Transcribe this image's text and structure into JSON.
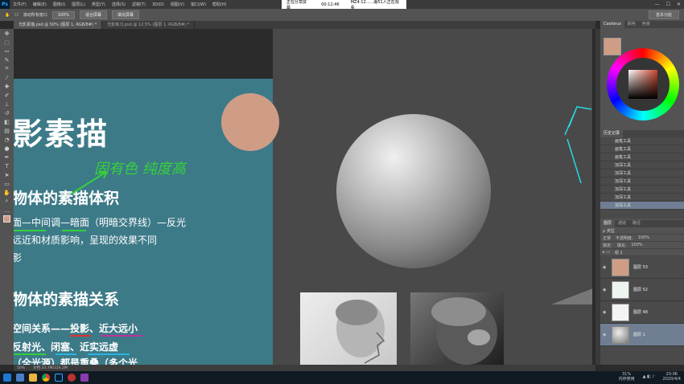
{
  "menubar": {
    "logo": "Ps",
    "items": [
      "文件(F)",
      "编辑(E)",
      "图像(I)",
      "图层(L)",
      "类型(Y)",
      "选择(S)",
      "滤镜(T)",
      "3D(D)",
      "视图(V)",
      "窗口(W)",
      "帮助(H)"
    ],
    "share_status": "正在分享屏幕",
    "share_time": "00:12:46",
    "share_viewers": "MZ4-12......服51人正在观看",
    "win_controls": [
      "—",
      "☐",
      "✕"
    ]
  },
  "options": {
    "checkbox_label": "滚动所有窗口",
    "zoom": "100%",
    "fit_screen": "适合屏幕",
    "fill_screen": "填充屏幕",
    "workspace": "基本功能"
  },
  "tabs": [
    {
      "label": "光影素描.psd @ 50% (图层 1, RGB/8#) *"
    },
    {
      "label": "光影练习.psd @ 12.5% (图层 1, RGB/8#) *"
    }
  ],
  "slide": {
    "title": "影素描",
    "line1": "物体的素描体积",
    "line2": "面—中间调—暗面（明暗交界线）—反光",
    "line3": "远近和材质影响，呈现的效果不同",
    "line4": "影",
    "line5": "物体的素描关系",
    "line6": "空间关系——投影、近大远小",
    "line7": "反射光、闭塞、近实远虚",
    "line8": "（全光源）都是重叠（多个光",
    "handwriting": "固有色 纯度高"
  },
  "status": {
    "zoom": "50%",
    "doc": "文档:33.7M/224.2M"
  },
  "panels": {
    "color_tabs": [
      "Coolorus",
      "颜色",
      "色板"
    ],
    "history_tabs": [
      "历史记录"
    ],
    "history_items": [
      "画笔工具",
      "画笔工具",
      "画笔工具",
      "加深工具",
      "加深工具",
      "加深工具",
      "加深工具",
      "加深工具",
      "加深工具"
    ],
    "layers_tabs": [
      "图层",
      "通道",
      "路径"
    ],
    "filter": "ρ 类型",
    "blend": "正常",
    "opacity_label": "不透明度:",
    "opacity": "100%",
    "lock_label": "锁定:",
    "fill_label": "填充:",
    "fill": "100%",
    "group": "组 2",
    "layers": [
      {
        "name": "图层 53"
      },
      {
        "name": "图层 52"
      },
      {
        "name": "图层 48"
      },
      {
        "name": "图层 1"
      }
    ]
  },
  "taskbar": {
    "memory_pct": "31%",
    "memory_label": "内存使用",
    "time": "20:06",
    "date": "2020/4/4"
  },
  "colors": {
    "slide_bg": "#3d7a88",
    "swatch": "#cf9d86",
    "handwriting": "#35d13a"
  }
}
